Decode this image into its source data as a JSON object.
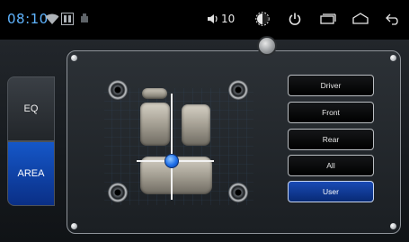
{
  "status_bar": {
    "time": "08:10",
    "volume": "10",
    "icons": [
      "wifi-icon",
      "storage-icon",
      "usb-icon",
      "volume-icon",
      "brightness-icon",
      "power-icon",
      "recent-apps-icon",
      "home-icon",
      "back-icon"
    ]
  },
  "tabs": [
    {
      "label": "EQ",
      "selected": false
    },
    {
      "label": "AREA",
      "selected": true
    }
  ],
  "area_buttons": [
    {
      "label": "Driver",
      "selected": false
    },
    {
      "label": "Front",
      "selected": false
    },
    {
      "label": "Rear",
      "selected": false
    },
    {
      "label": "All",
      "selected": false
    },
    {
      "label": "User",
      "selected": true
    }
  ],
  "colors": {
    "accent_blue": "#1557c8",
    "time_blue": "#5fb4ff",
    "button_active": "#0a2f86"
  }
}
